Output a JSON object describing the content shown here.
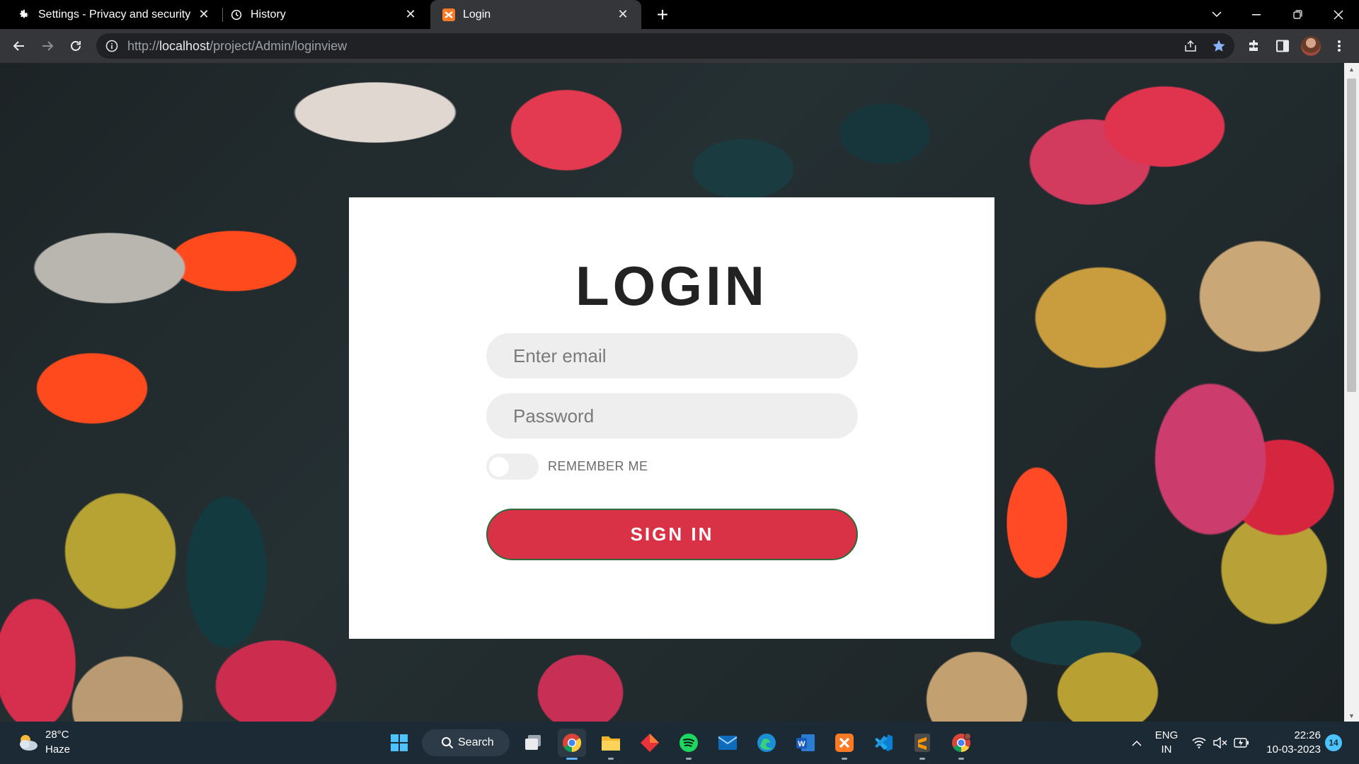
{
  "tabs": [
    {
      "title": "Settings - Privacy and security",
      "icon": "gear-icon"
    },
    {
      "title": "History",
      "icon": "history-icon"
    },
    {
      "title": "Login",
      "icon": "xampp-icon",
      "active": true
    }
  ],
  "address": {
    "prefix": "http://",
    "host": "localhost",
    "path": "/project/Admin/loginview"
  },
  "login": {
    "heading": "LOGIN",
    "email_placeholder": "Enter email",
    "password_placeholder": "Password",
    "remember_label": "REMEMBER ME",
    "remember_on": false,
    "signin_label": "SIGN IN",
    "accent_color": "#d93145"
  },
  "taskbar": {
    "weather_temp": "28°C",
    "weather_cond": "Haze",
    "search_label": "Search",
    "apps": [
      "windows-start-icon",
      "search-icon",
      "task-view-icon",
      "chrome-icon",
      "file-explorer-icon",
      "app-diamond-icon",
      "spotify-icon",
      "mail-icon",
      "edge-icon",
      "word-icon",
      "xampp-icon",
      "vscode-icon",
      "sublime-icon",
      "chrome-profile-icon"
    ],
    "lang_1": "ENG",
    "lang_2": "IN",
    "time": "22:26",
    "date": "10-03-2023",
    "notifications": "14"
  }
}
